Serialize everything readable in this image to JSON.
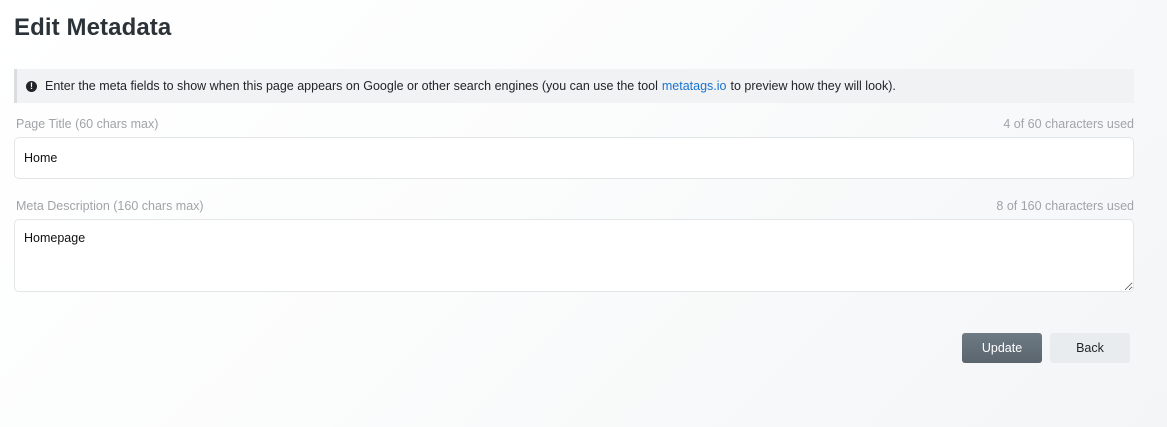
{
  "page": {
    "title": "Edit Metadata"
  },
  "notice": {
    "icon": "exclamation-circle-icon",
    "text_before": "Enter the meta fields to show when this page appears on Google or other search engines (you can use the tool",
    "link_text": "metatags.io",
    "text_after": "to preview how they will look)."
  },
  "page_title_field": {
    "label": "Page Title (60 chars max)",
    "counter": "4 of 60 characters used",
    "value": "Home"
  },
  "meta_description_field": {
    "label": "Meta Description (160 chars max)",
    "counter": "8 of 160 characters used",
    "value": "Homepage"
  },
  "actions": {
    "update_label": "Update",
    "back_label": "Back"
  },
  "colors": {
    "link": "#1a73d1",
    "update_button": "#5f6b74",
    "back_button": "#e9ecef"
  }
}
